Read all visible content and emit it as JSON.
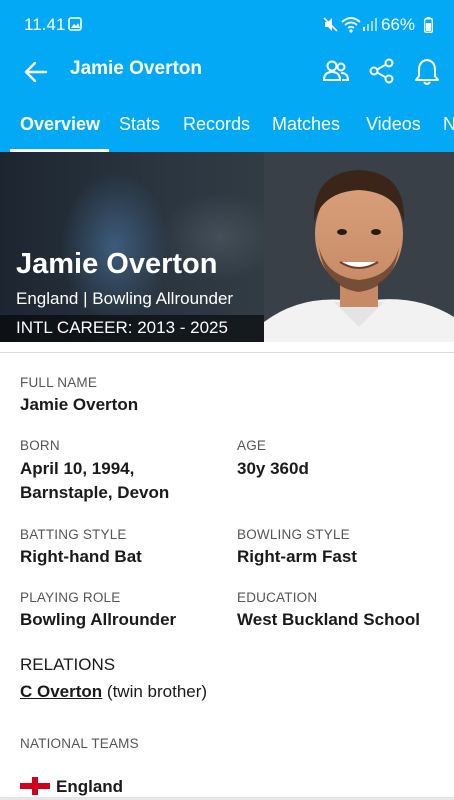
{
  "status": {
    "time": "11.41",
    "battery": "66%"
  },
  "header": {
    "title": "Jamie Overton"
  },
  "tabs": [
    "Overview",
    "Stats",
    "Records",
    "Matches",
    "Videos",
    "N"
  ],
  "hero": {
    "name": "Jamie Overton",
    "meta": "England | Bowling Allrounder",
    "career": "INTL CAREER: 2013 - 2025"
  },
  "details": {
    "full_name_label": "FULL NAME",
    "full_name": "Jamie Overton",
    "born_label": "BORN",
    "born_line1": "April 10, 1994,",
    "born_line2": "Barnstaple, Devon",
    "age_label": "AGE",
    "age": "30y 360d",
    "batting_label": "BATTING STYLE",
    "batting": "Right-hand Bat",
    "bowling_label": "BOWLING STYLE",
    "bowling": "Right-arm Fast",
    "role_label": "PLAYING ROLE",
    "role": "Bowling Allrounder",
    "education_label": "EDUCATION",
    "education": "West Buckland School"
  },
  "relations": {
    "title": "RELATIONS",
    "name": "C Overton",
    "note": "(twin brother)"
  },
  "national_teams": {
    "label": "NATIONAL TEAMS",
    "team": "England"
  },
  "icons": [
    "image-icon",
    "mute-icon",
    "wifi-icon",
    "signal-icon",
    "battery-icon",
    "back-arrow-icon",
    "people-icon",
    "share-icon",
    "bell-icon",
    "england-flag-icon"
  ],
  "colors": {
    "brand": "#03a9f4"
  }
}
